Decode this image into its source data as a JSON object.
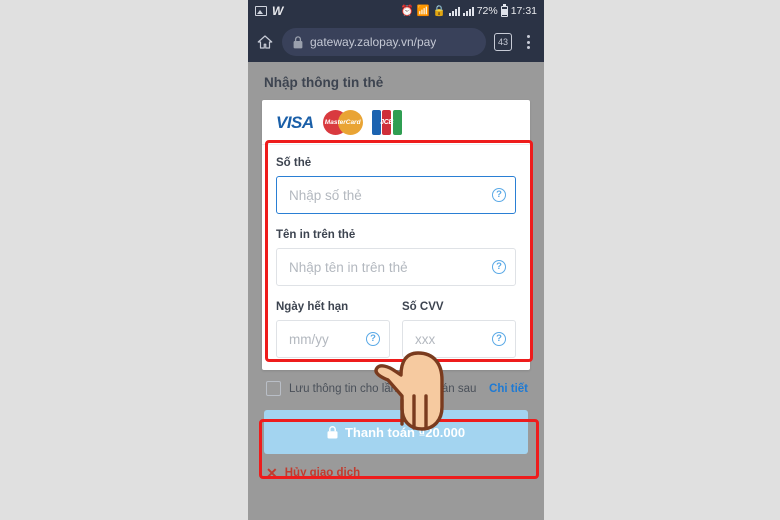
{
  "statusbar": {
    "icons_left": [
      "photo-icon",
      "w-icon"
    ],
    "icons_right": [
      "alarm-icon",
      "wifi-icon",
      "sync-icon",
      "signal-1-icon",
      "signal-2-icon"
    ],
    "battery_percent": "72%",
    "time": "17:31"
  },
  "browser": {
    "home_icon": "home-icon",
    "lock_icon": "lock-icon",
    "url": "gateway.zalopay.vn/pay",
    "tab_count": "43",
    "menu_icon": "overflow-menu-icon"
  },
  "page": {
    "title": "Nhập thông tin thẻ",
    "brands": [
      {
        "name": "visa",
        "label": "VISA"
      },
      {
        "name": "mastercard",
        "label": "MasterCard"
      },
      {
        "name": "jcb",
        "label": "JCB"
      }
    ],
    "fields": {
      "card_number": {
        "label": "Số thẻ",
        "value": "",
        "placeholder": "Nhập số thẻ",
        "help_icon": "?"
      },
      "card_name": {
        "label": "Tên in trên thẻ",
        "value": "",
        "placeholder": "Nhập tên in trên thẻ",
        "help_icon": "?"
      },
      "expiry": {
        "label": "Ngày hết hạn",
        "value": "",
        "placeholder": "mm/yy",
        "help_icon": "?"
      },
      "cvv": {
        "label": "Số CVV",
        "value": "",
        "placeholder": "xxx",
        "help_icon": "?"
      }
    },
    "save_info": {
      "label": "Lưu thông tin cho lần thanh toán sau",
      "checked": false,
      "detail_link": "Chi tiết"
    },
    "pay_button": {
      "label": "Thanh toán ₫20.000",
      "lock_icon": "lock-icon",
      "color": "#a3d4f0"
    },
    "cancel_link": {
      "label": "Hủy giao dịch",
      "icon": "close-x-icon",
      "color": "#c23b2e"
    }
  },
  "annotations": {
    "highlight_color": "#ee1c1c",
    "boxes": [
      "card-fields-highlight",
      "pay-button-highlight"
    ],
    "cursor": "pointing-hand-down"
  }
}
